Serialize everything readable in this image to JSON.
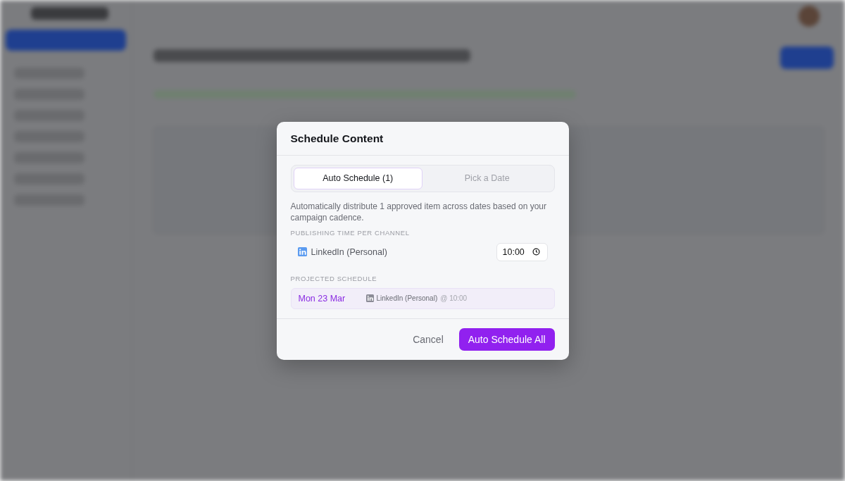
{
  "dialog": {
    "title": "Schedule Content",
    "tabs": [
      {
        "label": "Auto Schedule (1)",
        "selected": true
      },
      {
        "label": "Pick a Date",
        "selected": false
      }
    ],
    "description": "Automatically distribute 1 approved item across dates based on your campaign cadence.",
    "channel_section": {
      "heading": "PUBLISHING TIME PER CHANNEL",
      "channels": [
        {
          "name": "LinkedIn (Personal)",
          "time": "10:00"
        }
      ]
    },
    "projected_section": {
      "heading": "PROJECTED SCHEDULE",
      "entries": [
        {
          "date": "Mon 23 Mar",
          "channel": "LinkedIn (Personal)",
          "time": "@ 10:00"
        }
      ]
    },
    "buttons": {
      "cancel": "Cancel",
      "confirm": "Auto Schedule All"
    }
  }
}
